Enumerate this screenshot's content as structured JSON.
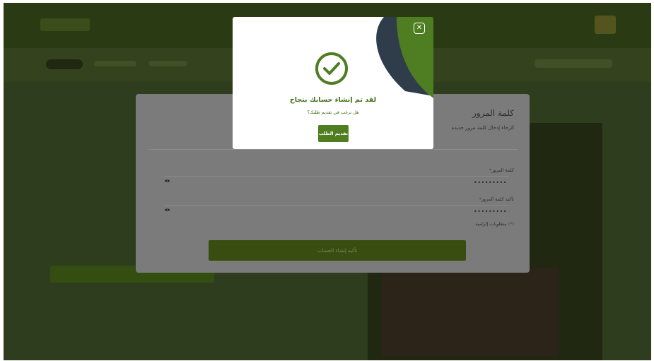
{
  "form": {
    "title": "كلمة المرور",
    "subtitle": "الرجاء إدخال كلمة مرور جديدة",
    "password_label": "كلمة المرور",
    "password_value": "•••••••••",
    "confirm_label": "تأكيد كلمة المرور",
    "confirm_value": "•••••••••",
    "required_asterisk": "*",
    "required_note": "مطلوبات إلزامية",
    "required_mark": "(*)",
    "submit_label": "تأكيد إنشاء الحساب"
  },
  "modal": {
    "title": "لقد تم إنشاء حسابك بنجاح",
    "question": "هل ترغب في تقديم طلبك؟",
    "button_label": "تقديم الطلب",
    "close_symbol": "✕",
    "icons": {
      "success": "check-circle-icon",
      "close": "close-icon",
      "visibility": "eye-icon"
    }
  },
  "colors": {
    "brand_green": "#4f7d21",
    "modal_accent_dark": "#2f3d4a",
    "overlay": "#2f3d1f"
  }
}
